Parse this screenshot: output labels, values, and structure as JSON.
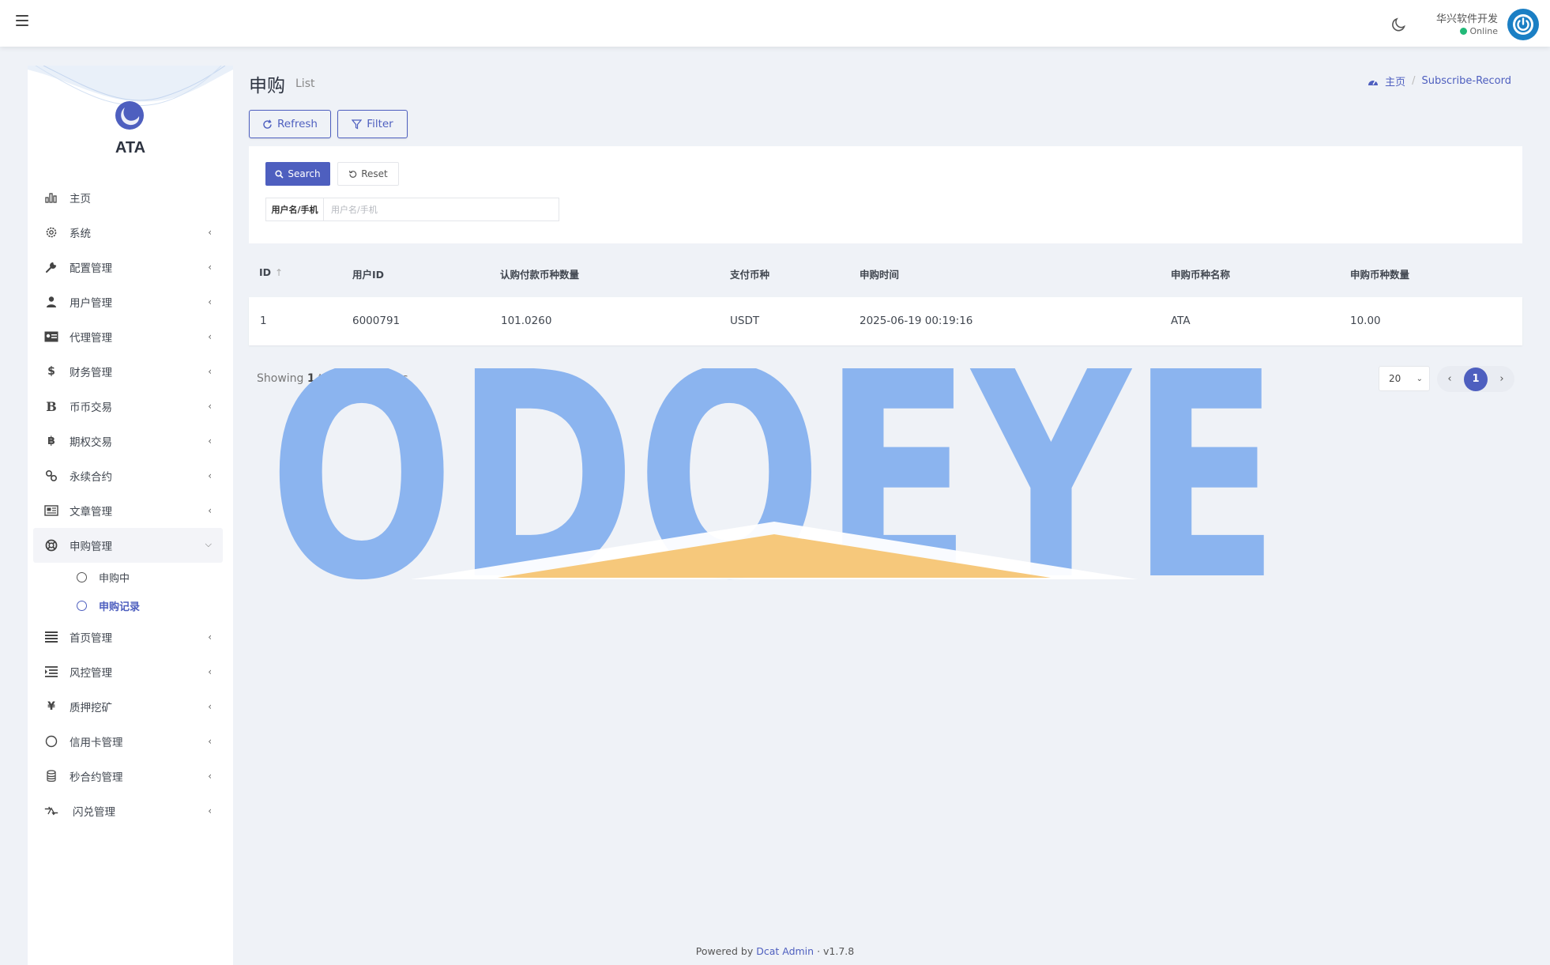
{
  "topbar": {
    "user_name": "华兴软件开发",
    "status": "Online"
  },
  "sidebar": {
    "logo_text": "ATA",
    "items": [
      {
        "label": "主页",
        "icon": "bar-chart-icon"
      },
      {
        "label": "系统",
        "icon": "gear-icon"
      },
      {
        "label": "配置管理",
        "icon": "wrench-icon"
      },
      {
        "label": "用户管理",
        "icon": "user-icon"
      },
      {
        "label": "代理管理",
        "icon": "id-card-icon"
      },
      {
        "label": "财务管理",
        "icon": "dollar-icon"
      },
      {
        "label": "币币交易",
        "icon": "bold-b-icon"
      },
      {
        "label": "期权交易",
        "icon": "bitcoin-icon"
      },
      {
        "label": "永续合约",
        "icon": "link-icon"
      },
      {
        "label": "文章管理",
        "icon": "newspaper-icon"
      },
      {
        "label": "申购管理",
        "icon": "lifebuoy-icon"
      },
      {
        "label": "首页管理",
        "icon": "list-icon"
      },
      {
        "label": "风控管理",
        "icon": "indent-icon"
      },
      {
        "label": "质押挖矿",
        "icon": "yen-icon"
      },
      {
        "label": "信用卡管理",
        "icon": "circle-icon"
      },
      {
        "label": "秒合约管理",
        "icon": "coins-icon"
      },
      {
        "label": "闪兑管理",
        "icon": "exchange-icon"
      }
    ],
    "subitems": [
      {
        "label": "申购中"
      },
      {
        "label": "申购记录"
      }
    ]
  },
  "header": {
    "title": "申购",
    "subtitle": "List",
    "breadcrumb_home": "主页",
    "breadcrumb_current": "Subscribe-Record"
  },
  "toolbar": {
    "refresh_label": "Refresh",
    "filter_label": "Filter"
  },
  "filter": {
    "search_label": "Search",
    "reset_label": "Reset",
    "field_label": "用户名/手机",
    "field_placeholder": "用户名/手机"
  },
  "table": {
    "columns": [
      "ID",
      "用户ID",
      "认购付款币种数量",
      "支付币种",
      "申购时间",
      "申购币种名称",
      "申购币种数量"
    ],
    "rows": [
      [
        "1",
        "6000791",
        "101.0260",
        "USDT",
        "2025-06-19 00:19:16",
        "ATA",
        "10.00"
      ]
    ]
  },
  "pagination": {
    "showing_prefix": "Showing",
    "from": "1",
    "to_word": "to",
    "to": "1",
    "of_word": "of",
    "total": "1",
    "entries_word": "entries",
    "per_page": "20",
    "current_page": "1"
  },
  "watermark": {
    "text": "ODOEYE"
  },
  "footer": {
    "powered_by": "Powered by",
    "link": "Dcat Admin",
    "sep": "·",
    "version": "v1.7.8"
  },
  "colors": {
    "primary": "#4e5fbf",
    "online": "#21b978",
    "watermark_blue": "#8bb4ef",
    "watermark_orange": "#f6c87b"
  }
}
